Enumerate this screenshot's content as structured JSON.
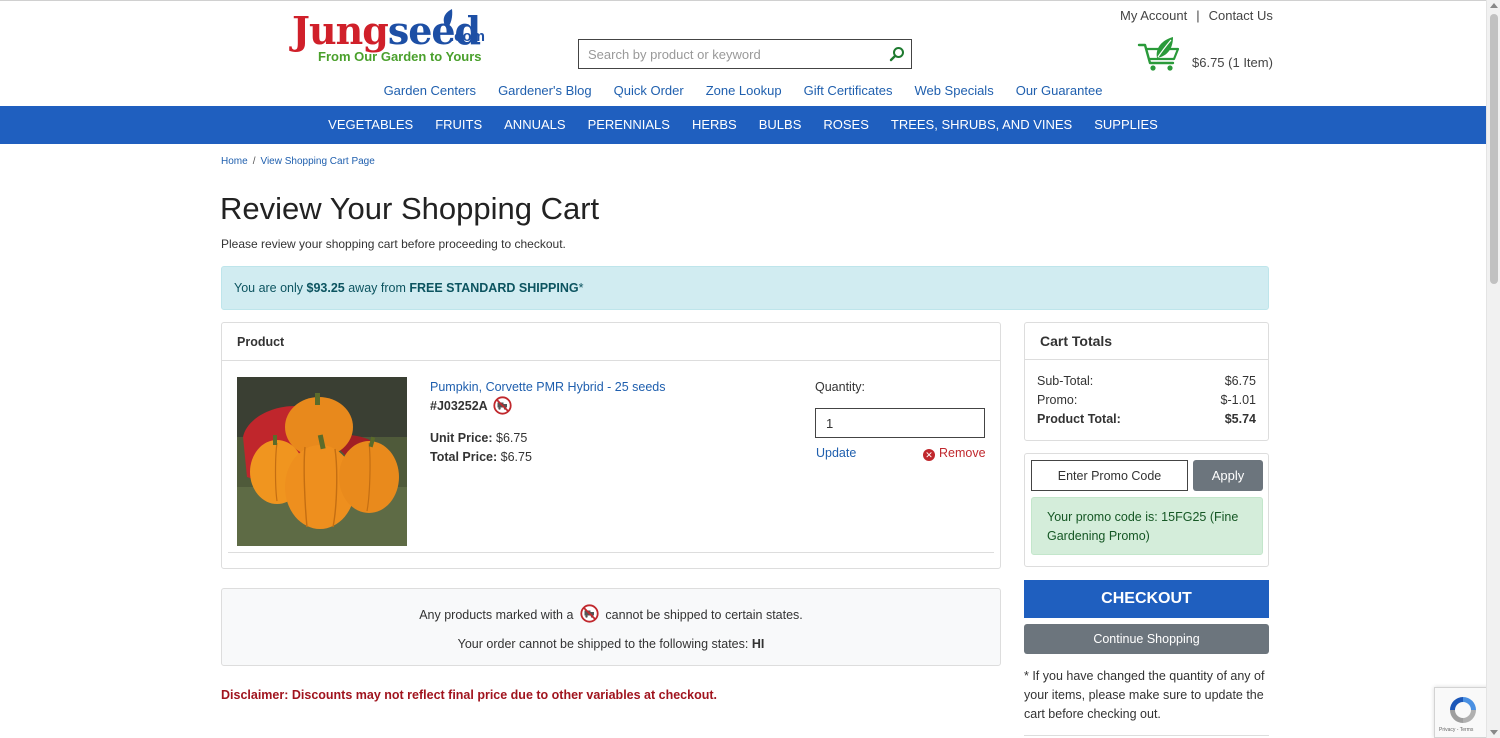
{
  "header": {
    "logo_word_a": "Jung",
    "logo_word_b": "seed",
    "logo_dotcom": ".com",
    "logo_tagline": "From Our Garden to Yours",
    "search_placeholder": "Search by product or keyword",
    "my_account": "My Account",
    "separator": "|",
    "contact_us": "Contact Us",
    "cart_summary": "$6.75 (1 Item)"
  },
  "sub_nav": [
    "Garden Centers",
    "Gardener's Blog",
    "Quick Order",
    "Zone Lookup",
    "Gift Certificates",
    "Web Specials",
    "Our Guarantee"
  ],
  "main_nav": [
    "VEGETABLES",
    "FRUITS",
    "ANNUALS",
    "PERENNIALS",
    "HERBS",
    "BULBS",
    "ROSES",
    "TREES, SHRUBS, AND VINES",
    "SUPPLIES"
  ],
  "breadcrumb": {
    "home": "Home",
    "sep": "/",
    "current": "View Shopping Cart Page"
  },
  "page": {
    "title": "Review Your Shopping Cart",
    "subtitle": "Please review your shopping cart before proceeding to checkout."
  },
  "shipping_alert": {
    "prefix": "You are only ",
    "amount": "$93.25",
    "middle": " away from ",
    "offer": "FREE STANDARD SHIPPING",
    "suffix": "*"
  },
  "product_table": {
    "header": "Product",
    "item": {
      "name": "Pumpkin, Corvette PMR Hybrid - 25 seeds",
      "sku": "#J03252A",
      "unit_price_label": "Unit Price:",
      "unit_price": " $6.75",
      "total_price_label": "Total Price:",
      "total_price": " $6.75",
      "quantity_label": "Quantity:",
      "quantity": "1",
      "update_label": "Update",
      "remove_label": "Remove"
    }
  },
  "shipping_notice": {
    "line1_prefix": "Any products marked with a",
    "line1_suffix": "cannot be shipped to certain states.",
    "line2_prefix": "Your order cannot be shipped to the following states: ",
    "line2_states": "HI"
  },
  "disclaimer": "Disclaimer: Discounts may not reflect final price due to other variables at checkout.",
  "cart_totals": {
    "title": "Cart Totals",
    "subtotal_label": "Sub-Total:",
    "subtotal": "$6.75",
    "promo_label": "Promo:",
    "promo": "$-1.01",
    "product_total_label": "Product Total:",
    "product_total": "$5.74"
  },
  "promo": {
    "placeholder": "Enter Promo Code",
    "apply_label": "Apply",
    "message": "Your promo code is: 15FG25 (Fine Gardening Promo)"
  },
  "actions": {
    "checkout_label": "CHECKOUT",
    "continue_label": "Continue Shopping",
    "note": "* If you have changed the quantity of any of your items, please make sure to update the cart before checking out."
  },
  "recaptcha_text": "Privacy - Terms",
  "colors": {
    "brand_blue": "#1f5fbf",
    "link_blue": "#1f5fae",
    "logo_red": "#d0202a",
    "logo_green": "#4aa02c",
    "alert_info_bg": "#d1ecf1",
    "promo_success_bg": "#d4edda",
    "disclaimer_red": "#a0141e",
    "secondary_gray": "#6c757d"
  }
}
